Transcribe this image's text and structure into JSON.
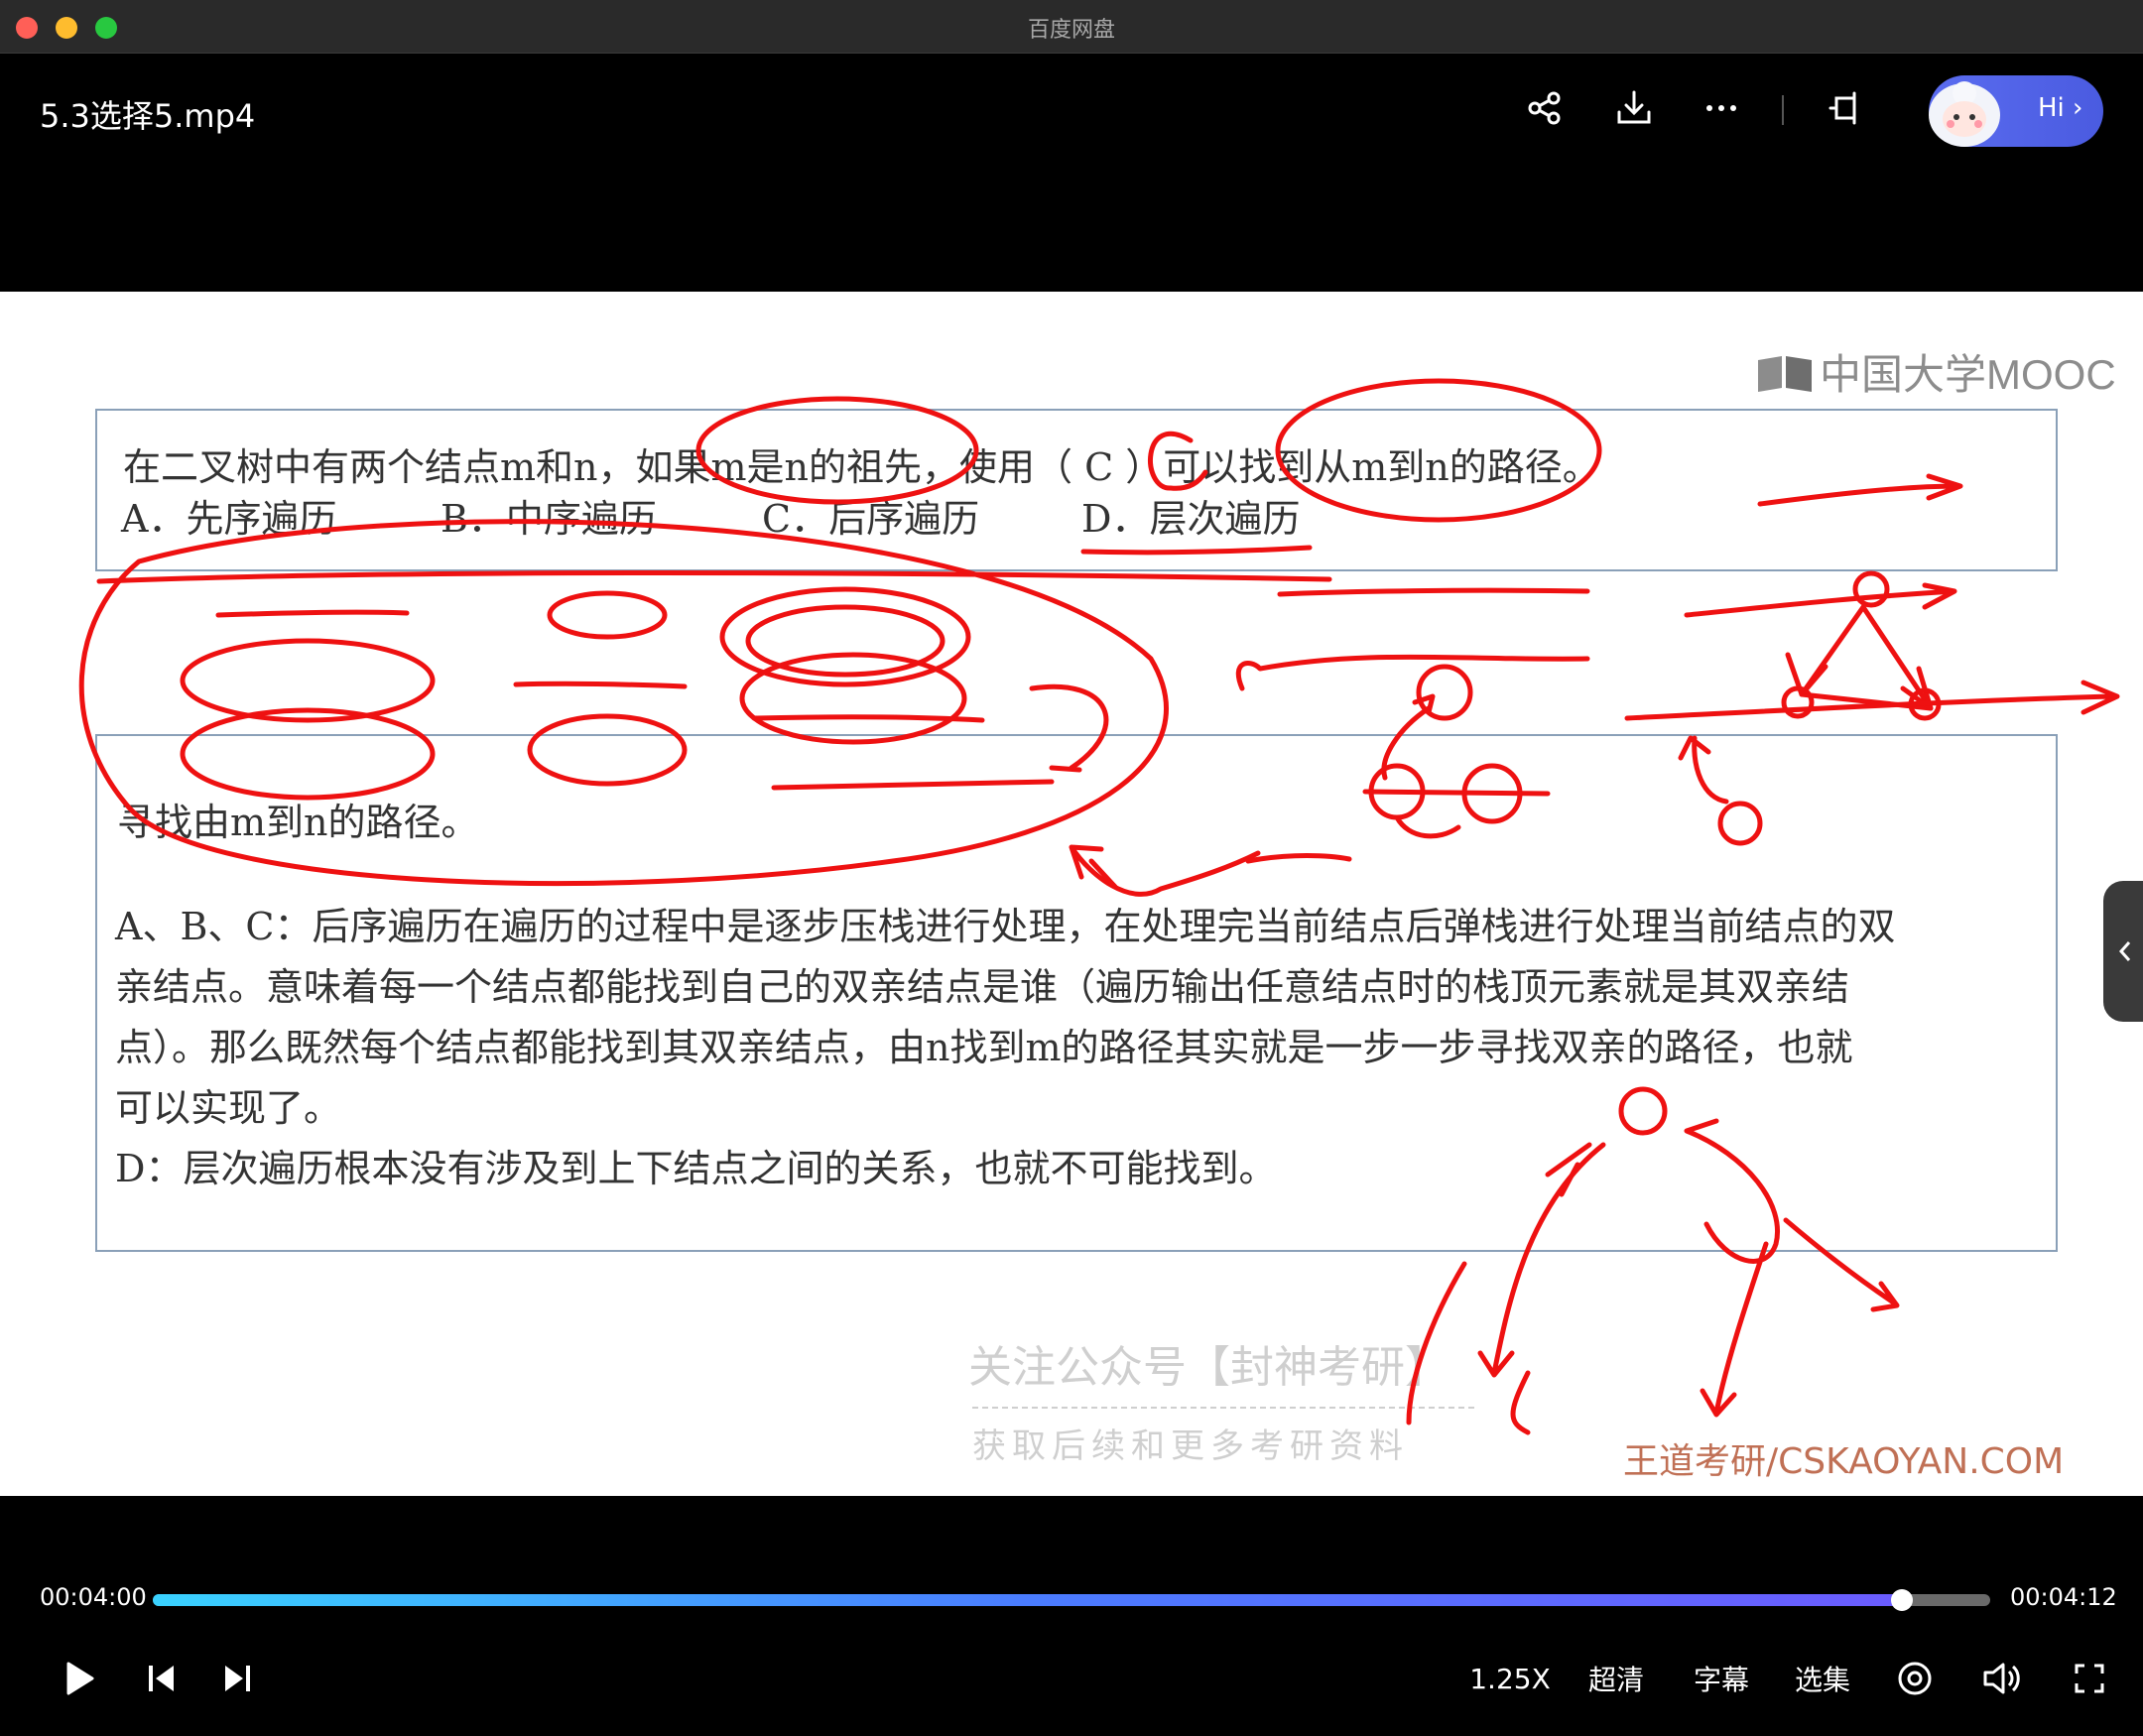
{
  "window": {
    "title": "百度网盘"
  },
  "header": {
    "file_title": "5.3选择5.mp4",
    "icons": [
      "share-icon",
      "download-icon",
      "more-icon",
      "picture-in-picture-icon"
    ],
    "assistant_label": "Hi"
  },
  "video": {
    "logo_text": "中国大学MOOC",
    "question": {
      "text": "在二叉树中有两个结点m和n，如果m是n的祖先，使用（ C ）可以找到从m到n的路径。",
      "options": [
        "A．先序遍历",
        "B．中序遍历",
        "C．后序遍历",
        "D．层次遍历"
      ]
    },
    "answer": {
      "title": "寻找由m到n的路径。",
      "paragraphs": [
        "A、B、C：后序遍历在遍历的过程中是逐步压栈进行处理，在处理完当前结点后弹栈进行处理当前结点的双",
        "亲结点。意味着每一个结点都能找到自己的双亲结点是谁（遍历输出任意结点时的栈顶元素就是其双亲结",
        "点）。那么既然每个结点都能找到其双亲结点，由n找到m的路径其实就是一步一步寻找双亲的路径，也就",
        "可以实现了。",
        "D：层次遍历根本没有涉及到上下结点之间的关系，也就不可能找到。"
      ]
    },
    "watermark": {
      "line1": "关注公众号【封神考研】",
      "line2": "获取后续和更多考研资料"
    },
    "brand": "王道考研/CSKAOYAN.COM",
    "annotation_color": "#ee1111"
  },
  "player": {
    "current_time": "00:04:00",
    "total_time": "00:04:12",
    "progress_percent": 95.2,
    "speed": "1.25X",
    "quality": "超清",
    "subtitles": "字幕",
    "episodes": "选集",
    "accent_color": "#3ad2ff"
  }
}
